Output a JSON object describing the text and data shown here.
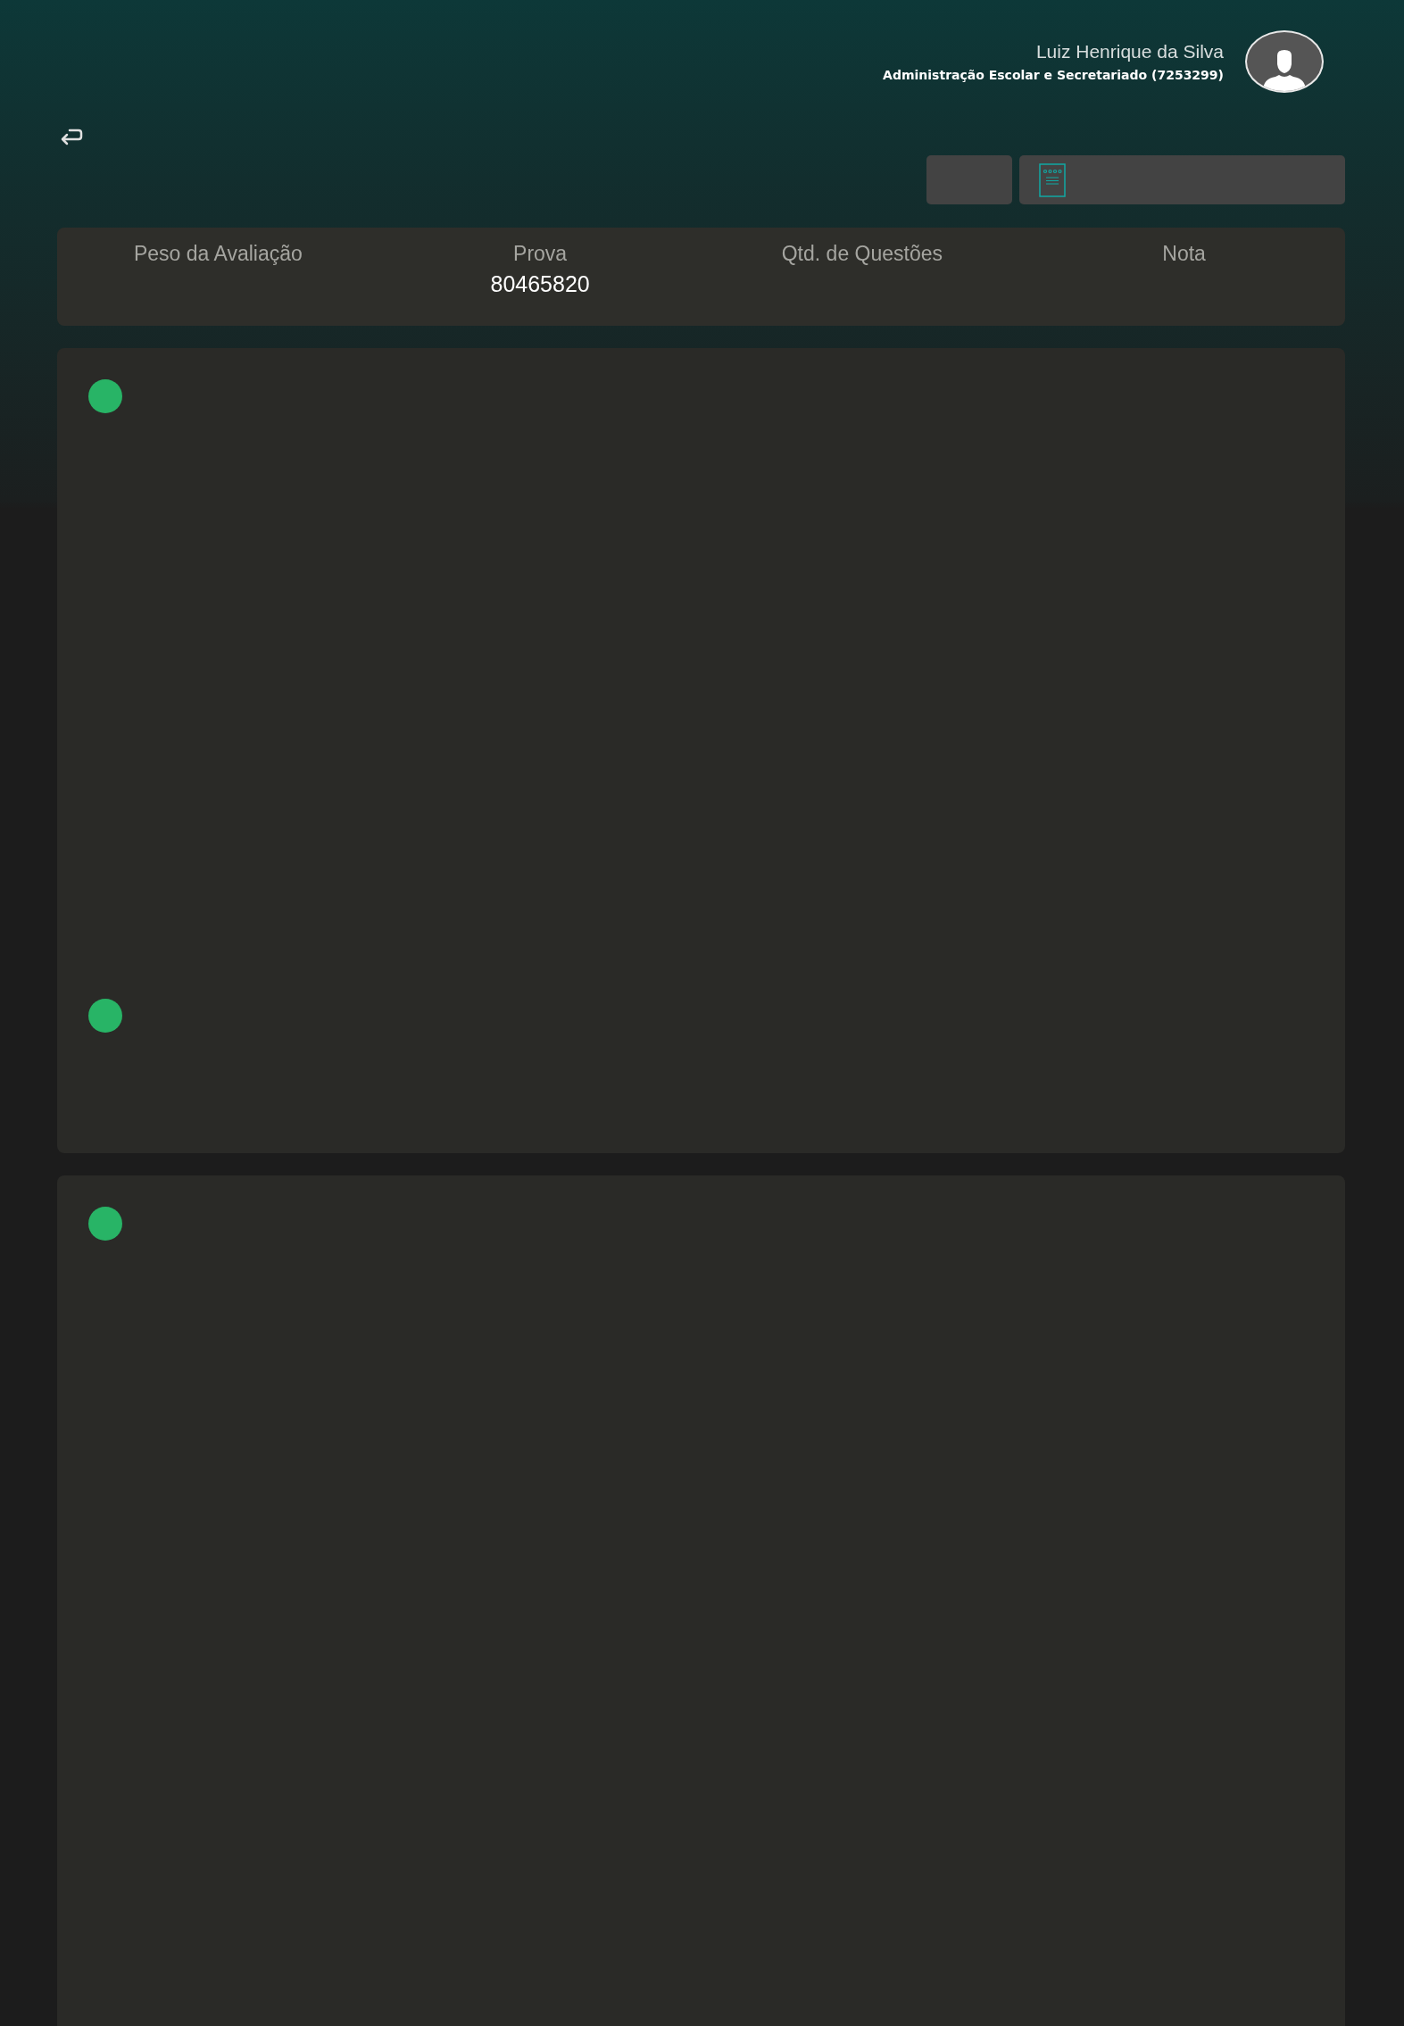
{
  "user": {
    "name": "Luiz Henrique da Silva",
    "course": "Administração Escolar e Secretariado (7253299)"
  },
  "summary": [
    {
      "label": "Peso da Avaliação"
    },
    {
      "label": "Prova",
      "value": "80465820"
    },
    {
      "label": "Qtd. de Questões"
    },
    {
      "label": "Nota"
    }
  ],
  "cards": [
    {
      "markers": [
        {
          "color": "#28b466"
        },
        {
          "color": "#28b466"
        }
      ]
    },
    {
      "markers": [
        {
          "color": "#28b466"
        }
      ]
    }
  ]
}
